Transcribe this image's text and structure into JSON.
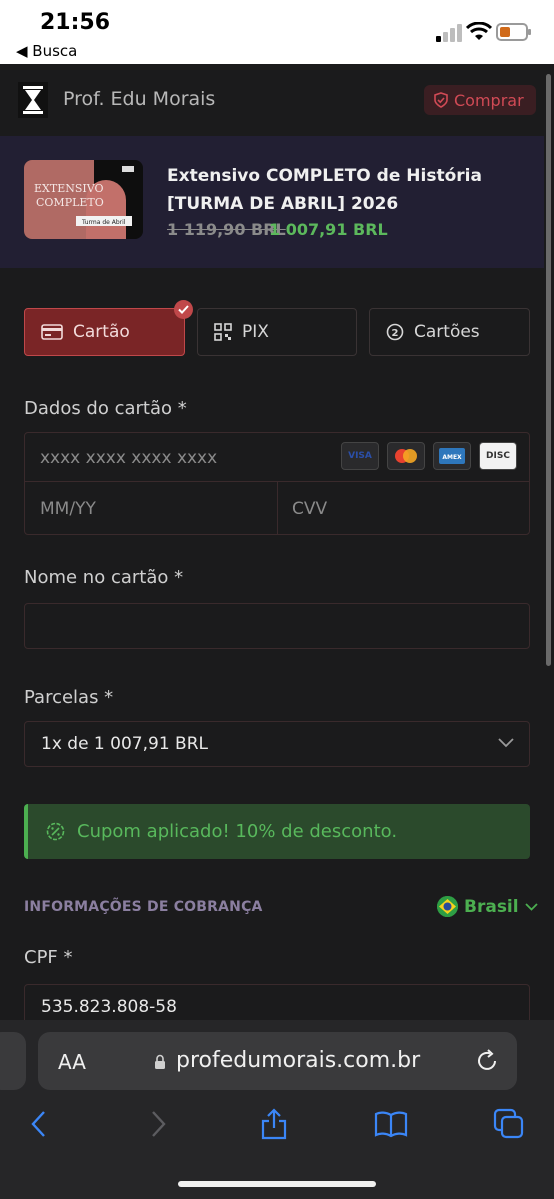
{
  "status_bar": {
    "time": "21:56",
    "back_label": "◀ Busca"
  },
  "header": {
    "brand": "Prof. Edu Morais",
    "buy_label": "Comprar"
  },
  "product": {
    "title": "Extensivo COMPLETO de História [TURMA DE ABRIL] 2026",
    "old_price": "1 119,90 BRL",
    "new_price": "1 007,91 BRL",
    "thumb_title_line1": "EXTENSIVO",
    "thumb_title_line2": "COMPLETO",
    "thumb_tag": "Turma de Abril"
  },
  "payment_tabs": [
    {
      "label": "Cartão",
      "icon": "credit-card-icon",
      "active": true
    },
    {
      "label": "PIX",
      "icon": "qr-code-icon",
      "active": false
    },
    {
      "label": "Cartões",
      "icon": "number-two-icon",
      "active": false
    }
  ],
  "card_form": {
    "section_label": "Dados do cartão *",
    "number_placeholder": "xxxx xxxx xxxx xxxx",
    "expiry_placeholder": "MM/YY",
    "cvv_placeholder": "CVV",
    "brands": [
      "VISA",
      "mastercard",
      "AMEX",
      "DISC"
    ]
  },
  "name_field": {
    "label": "Nome no cartão *",
    "value": ""
  },
  "installments": {
    "label": "Parcelas *",
    "value": "1x de 1 007,91 BRL"
  },
  "coupon": {
    "message": "Cupom aplicado! 10% de desconto."
  },
  "billing": {
    "heading": "INFORMAÇÕES DE COBRANÇA",
    "country": "Brasil"
  },
  "cpf": {
    "label": "CPF *",
    "value": "535.823.808-58"
  },
  "browser": {
    "url": "profedumorais.com.br",
    "aa": "AA"
  },
  "colors": {
    "accent": "#7a2526",
    "success": "#4caf50",
    "banner": "#221f33"
  }
}
